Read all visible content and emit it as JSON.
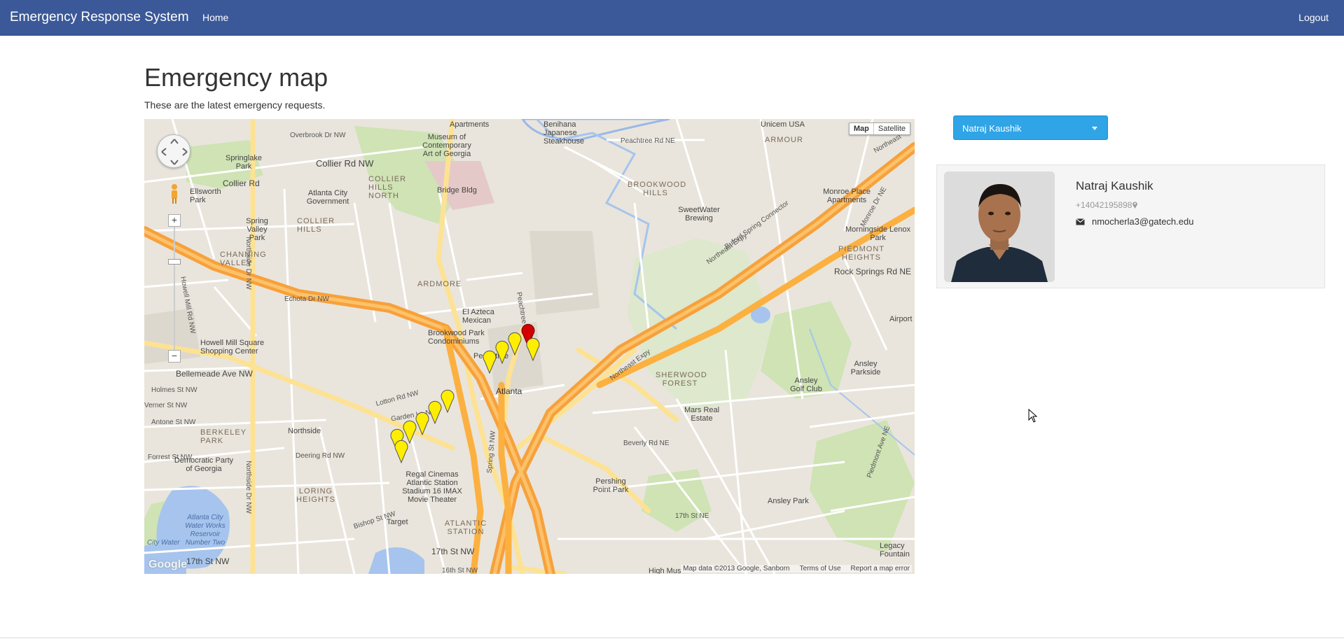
{
  "navbar": {
    "brand": "Emergency Response System",
    "home": "Home",
    "logout": "Logout",
    "color": "#3b5998"
  },
  "page": {
    "title": "Emergency map",
    "subtitle": "These are the latest emergency requests."
  },
  "map": {
    "map_type_options": [
      "Map",
      "Satellite"
    ],
    "selected_map_type": "Map",
    "attribution": "Map data ©2013 Google, Sanborn",
    "terms": "Terms of Use",
    "report": "Report a map error",
    "logo": "Google",
    "pins": {
      "active_color": "#d40000",
      "other_color": "#ffee00",
      "active_count": 1,
      "other_count": 10
    },
    "labels": {
      "apartments": "Apartments",
      "benihana": "Benihana Japanese Steakhouse",
      "unicem": "Unicem USA",
      "armour": "ARMOUR",
      "overbrook": "Overbrook Dr NW",
      "museum": "Museum of Contemporary Art of Georgia",
      "springlake": "Springlake Park",
      "collier_rd": "Collier Rd NW",
      "collier_rd2": "Collier Rd",
      "collier_hills_north": "COLLIER HILLS NORTH",
      "bridge_bldg": "Bridge Bldg",
      "brookwood_hills": "BROOKWOOD HILLS",
      "monroe_place": "Monroe Place Apartments",
      "ellsworth": "Ellsworth Park",
      "atlanta_city_gov": "Atlanta City Government",
      "collier_hills": "COLLIER HILLS",
      "spring_valley": "Spring Valley Park",
      "sweetwater": "SweetWater Brewing",
      "morningside": "Morningside Lenox Park",
      "piedmont_heights": "PIEDMONT HEIGHTS",
      "channing_valley": "CHANNING VALLEY",
      "ardmore": "ARDMORE",
      "rock_springs": "Rock Springs Rd NE",
      "echota": "Echota Dr NW",
      "el_azteca": "El Azteca Mexican",
      "brookwood_park": "Brookwood Park Condominiums",
      "howell_mill": "Howell Mill Square Shopping Center",
      "airport": "Airport",
      "bellemeade": "Bellemeade Ave NW",
      "peachtree": "Peachtree",
      "atlanta": "Atlanta",
      "sherwood_forest": "SHERWOOD FOREST",
      "ansley_golf": "Ansley Golf Club",
      "ansley_parkside": "Ansley Parkside",
      "holmes": "Holmes St NW",
      "verner": "Verner St NW",
      "antone": "Antone St NW",
      "berkeley_park": "BERKELEY PARK",
      "northside": "Northside",
      "mars_real_estate": "Mars Real Estate",
      "beverly": "Beverly Rd NE",
      "forrest": "Forrest St NW",
      "democratic_party": "Democratic Party of Georgia",
      "deering": "Deering Rd NW",
      "regal": "Regal Cinemas Atlantic Station Stadium 16 IMAX Movie Theater",
      "pershing": "Pershing Point Park",
      "loring_heights": "LORING HEIGHTS",
      "water_works": "Atlanta City Water Works Reservoir Number Two",
      "target": "Target",
      "atlantic_station": "ATLANTIC STATION",
      "ansley_park": "Ansley Park",
      "17th_st_ne": "17th St NE",
      "17th_st_nw": "17th St NW",
      "17th_st_sw": "17th St NW",
      "legacy_fountain": "Legacy Fountain",
      "high_mus": "High Mus",
      "16th_st": "16th St NW",
      "bishop": "Bishop St NW",
      "peachtree_rd": "Peachtree Rd NE",
      "peachtree_st": "Peachtree St",
      "northeast_expy": "Northeast Expy",
      "northeast_expy2": "Northeast Expy",
      "northeast": "Northeast",
      "buford": "Buford Spring Connector",
      "northside_dr": "Northside Dr NW",
      "northside_dr2": "Northside Dr NW",
      "monroe_dr": "Monroe Dr NE",
      "piedmont_ave": "Piedmont Ave NE",
      "spring_st": "Spring St NW",
      "water_works_reservoir": "City Water",
      "lotton": "Lotton Rd NW",
      "garden_ln": "Garden Ln NW",
      "hampton": "Howell Mill Rd NW"
    }
  },
  "user_select": {
    "selected": "Natraj Kaushik",
    "color": "#2fa4e7"
  },
  "profile": {
    "name": "Natraj Kaushik",
    "phone": "+14042195898",
    "email": "nmocherla3@gatech.edu"
  }
}
